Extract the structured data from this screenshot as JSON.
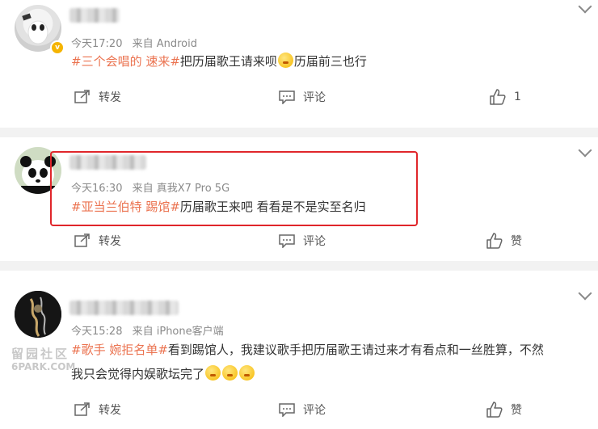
{
  "posts": [
    {
      "time": "今天17:20",
      "source": "来自 Android",
      "tag1": "#三个会唱的 速来#",
      "text1": "把历届歌王请来呗",
      "text2": "历届前三也行",
      "repost": "转发",
      "comment": "评论",
      "like": "1"
    },
    {
      "time": "今天16:30",
      "source": "来自 真我X7 Pro 5G",
      "tag1": "#亚当兰伯特 踢馆#",
      "text1": "历届歌王来吧 看看是不是实至名归",
      "repost": "转发",
      "comment": "评论",
      "like": "赞"
    },
    {
      "time": "今天15:28",
      "source": "来自 iPhone客户端",
      "tag1": "#歌手 婉拒名单#",
      "text1": "看到踢馆人，我建议歌手把历届歌王请过来才有看点和一丝胜算，不然",
      "text2": "我只会觉得内娱歌坛完了",
      "repost": "转发",
      "comment": "评论",
      "like": "赞"
    }
  ],
  "watermark": {
    "line1": "留园社区",
    "line2": "6PARK.COM"
  },
  "icons": {
    "repost": "share-icon",
    "comment": "comment-icon",
    "like": "thumbs-up-icon",
    "more": "chevron-down-icon"
  },
  "colors": {
    "tag": "#eb7350",
    "highlight_box": "#e0262b",
    "divider": "#f2f2f2"
  }
}
